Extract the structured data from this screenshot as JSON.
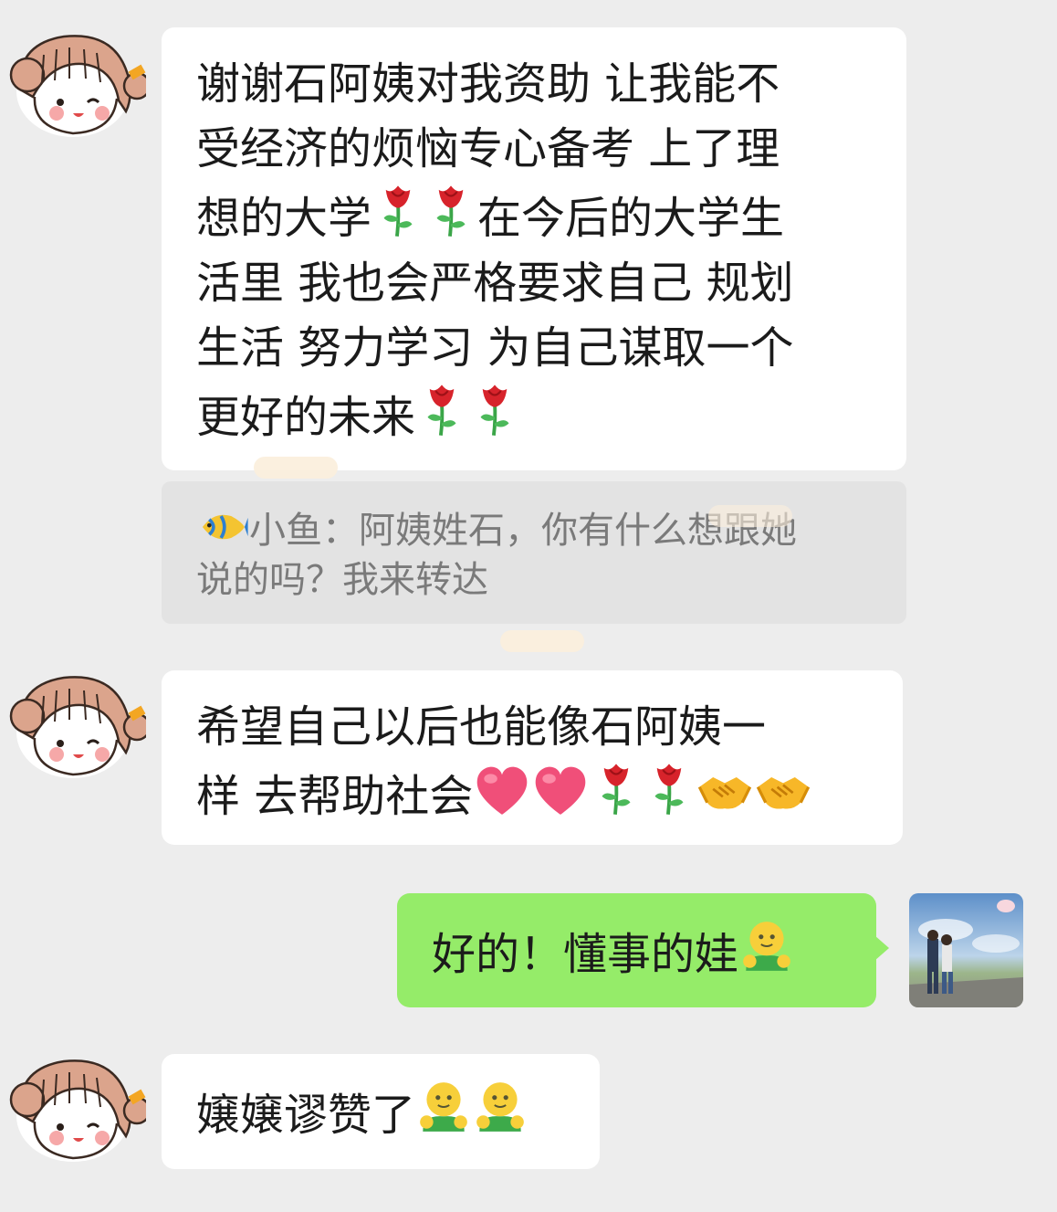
{
  "messages": [
    {
      "id": "m1",
      "lines": [
        "谢谢石阿姨对我资助 让我能不",
        "受经济的烦恼专心备考 上了理",
        "想的大学",
        "在今后的大学生",
        "活里 我也会严格要求自己 规划",
        "生活 努力学习 为自己谋取一个",
        "更好的未来"
      ]
    },
    {
      "id": "quote",
      "sender": "小鱼：",
      "line1": "阿姨姓石，你有什么想跟她",
      "line2": "说的吗？我来转达"
    },
    {
      "id": "m2",
      "line1": "希望自己以后也能像石阿姨一",
      "line2": "样 去帮助社会"
    },
    {
      "id": "m3",
      "text": "好的！懂事的娃"
    },
    {
      "id": "m4",
      "text": "嬢嬢谬赞了"
    }
  ],
  "icons": {
    "avatar_left": "cartoon-girl-avatar-icon",
    "avatar_self": "couple-photo-avatar-icon",
    "rose": "rose-emoji-icon",
    "heart": "heart-emoji-icon",
    "handshake": "handshake-emoji-icon",
    "fish": "tropical-fish-emoji-icon",
    "hug": "hugging-face-emoji-icon"
  },
  "colors": {
    "background": "#ededed",
    "bubble_other": "#ffffff",
    "bubble_self": "#95ec69",
    "quote_bg": "#e3e3e3",
    "quote_text": "#7a7a7a"
  }
}
